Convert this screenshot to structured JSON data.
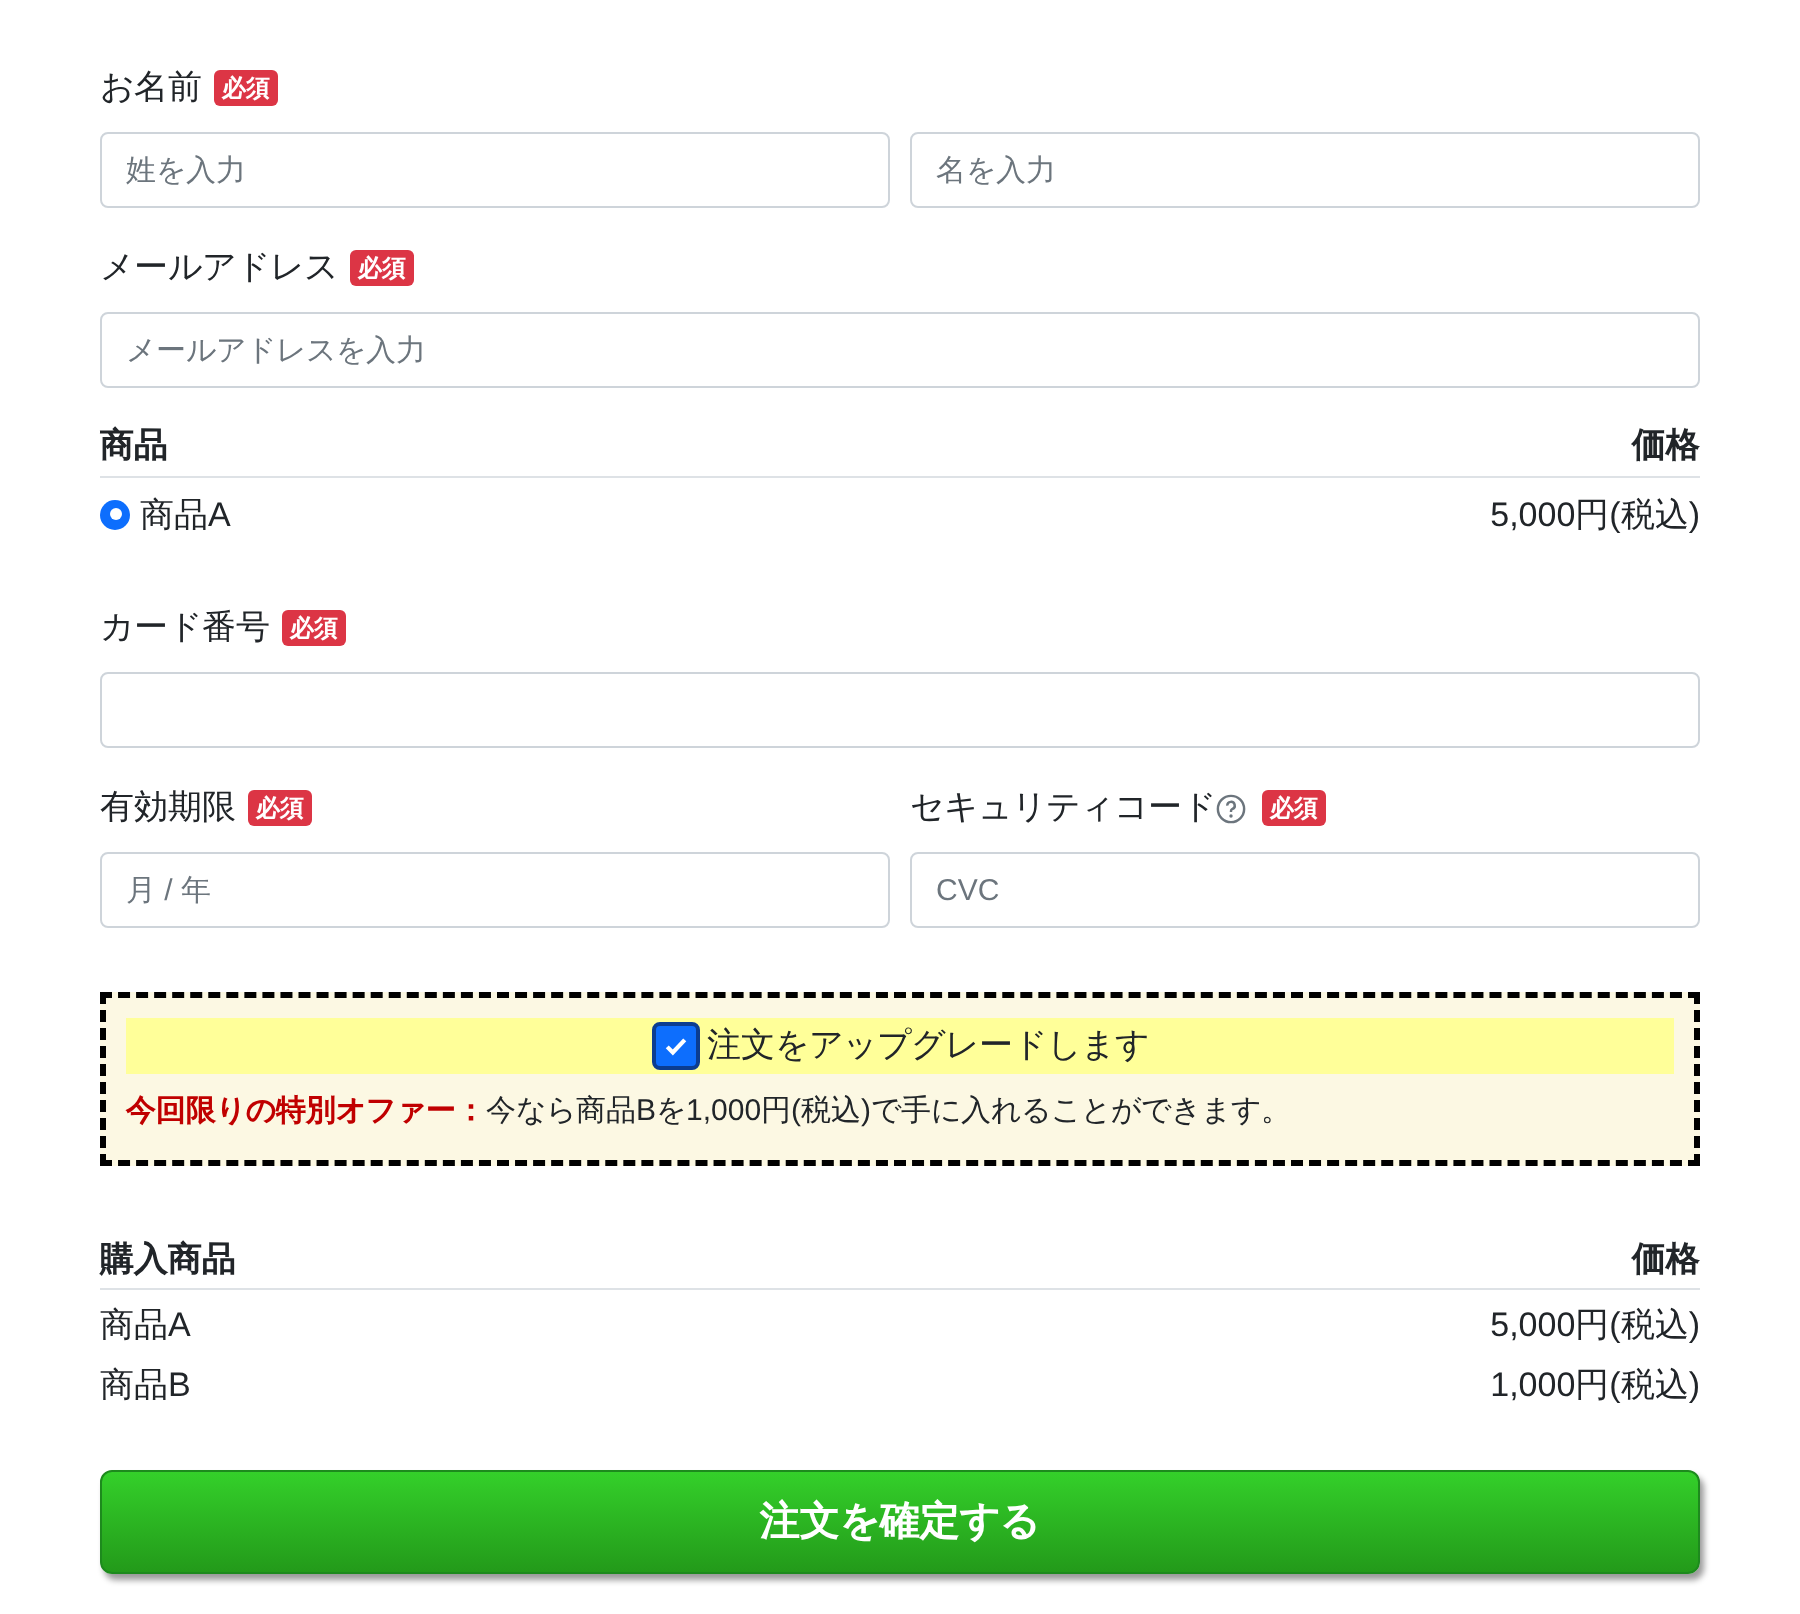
{
  "name": {
    "label": "お名前",
    "badge": "必須",
    "fields": [
      {
        "placeholder": "姓を入力"
      },
      {
        "placeholder": "名を入力"
      }
    ]
  },
  "email": {
    "label": "メールアドレス",
    "badge": "必須",
    "placeholder": "メールアドレスを入力"
  },
  "products": {
    "columns": [
      "商品",
      "価格"
    ],
    "items": [
      {
        "name": "商品A",
        "price": "5,000円(税込)",
        "selected": true
      }
    ]
  },
  "card": {
    "label": "カード番号",
    "badge": "必須"
  },
  "expiry": {
    "label": "有効期限",
    "badge": "必須",
    "placeholder": "月 / 年"
  },
  "cvc": {
    "label": "セキュリティコード",
    "badge": "必須",
    "help": true,
    "placeholder": "CVC"
  },
  "upgrade": {
    "label": "注文をアップグレードします",
    "checked": true,
    "offer": "**今回限りの特別オファー：**今なら商品Bを1,000円(税込)で手に入れることができます。"
  },
  "summary": {
    "columns": [
      "購入商品",
      "価格"
    ],
    "rows": [
      {
        "name": "商品A",
        "price": "5,000円(税込)"
      },
      {
        "name": "商品B",
        "price": "1,000円(税込)"
      }
    ]
  },
  "submit": "注文を確定する"
}
